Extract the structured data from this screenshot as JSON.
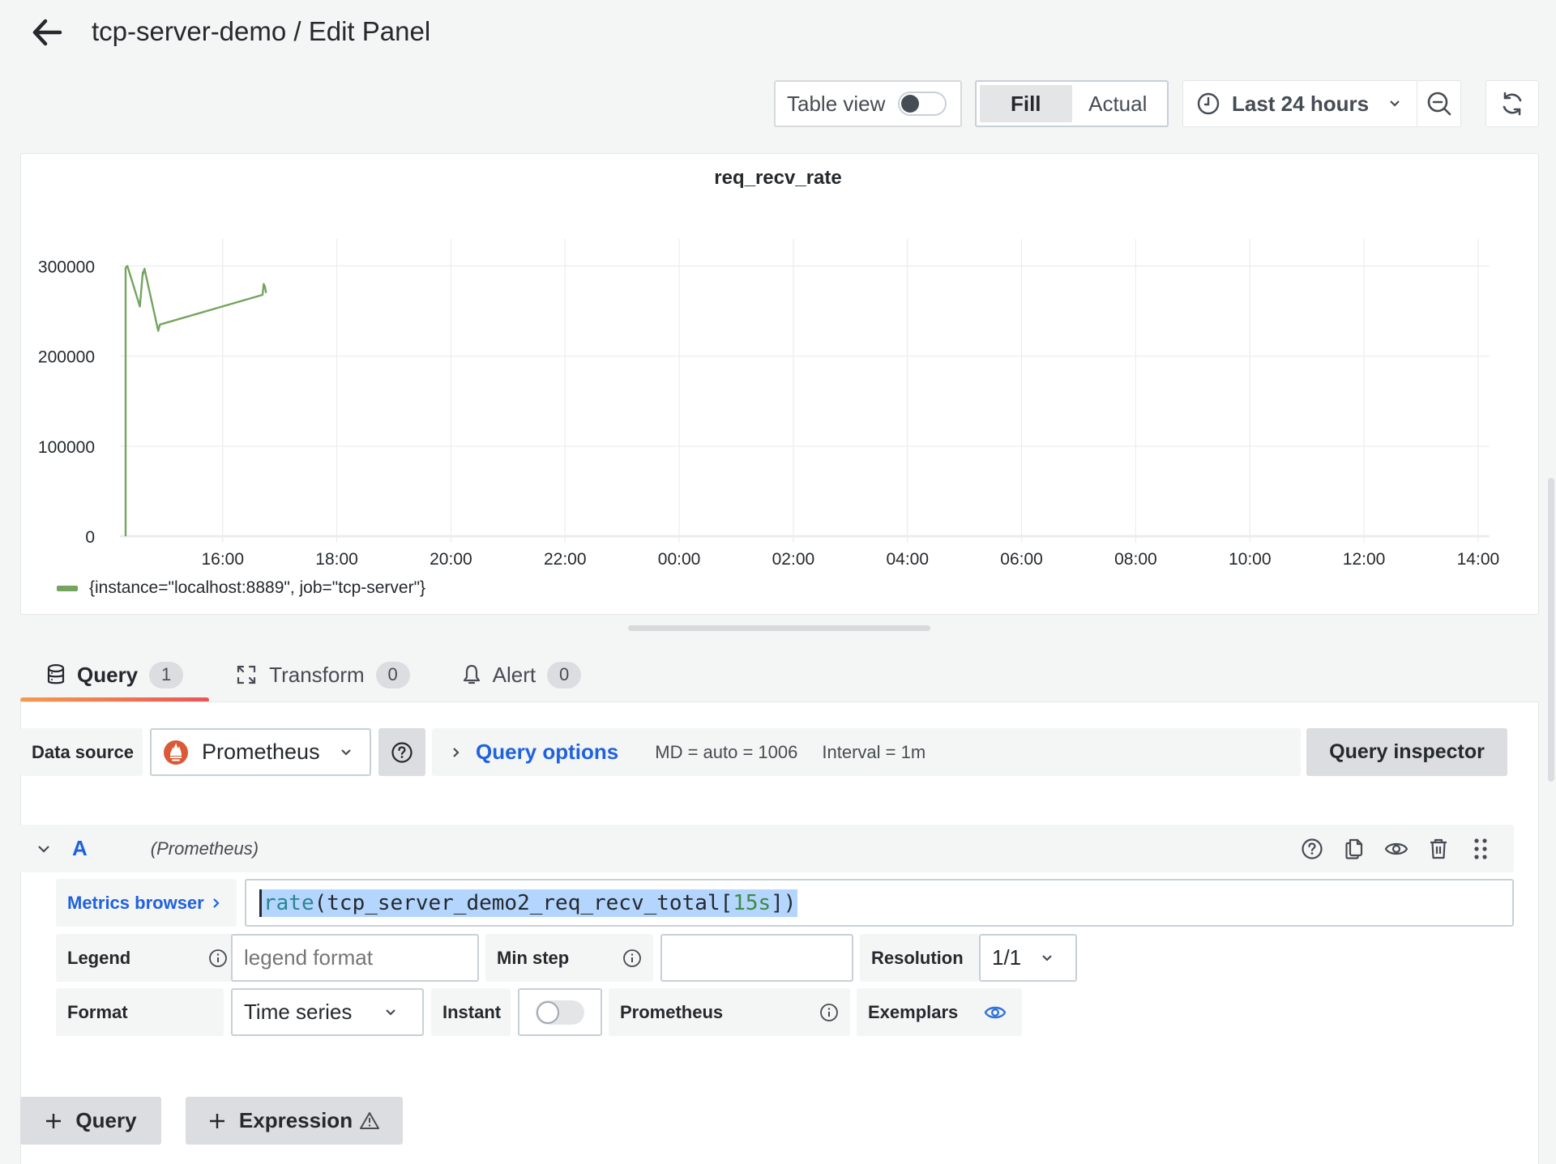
{
  "header": {
    "title": "tcp-server-demo / Edit Panel",
    "back_icon": "arrow-left-icon"
  },
  "toolbar": {
    "table_view_label": "Table view",
    "table_view_on": false,
    "fill_label": "Fill",
    "actual_label": "Actual",
    "selected_mode": "Fill",
    "time_range_label": "Last 24 hours",
    "time_icon": "clock-icon",
    "zoom_out_icon": "zoom-out-icon",
    "refresh_icon": "refresh-icon"
  },
  "panel": {
    "title": "req_recv_rate",
    "legend_label": "{instance=\"localhost:8889\", job=\"tcp-server\"}",
    "series_color": "#73a55e"
  },
  "chart_data": {
    "type": "line",
    "title": "req_recv_rate",
    "xlabel": "",
    "ylabel": "",
    "grid": true,
    "legend_position": "bottom-left",
    "y_ticks": [
      0,
      100000,
      200000,
      300000
    ],
    "y_tick_labels": [
      "0",
      "100000",
      "200000",
      "300000"
    ],
    "ylim": [
      0,
      330000
    ],
    "x_tick_labels": [
      "16:00",
      "18:00",
      "20:00",
      "22:00",
      "00:00",
      "02:00",
      "04:00",
      "06:00",
      "08:00",
      "10:00",
      "12:00",
      "14:00"
    ],
    "x_ticks_hours": [
      16,
      18,
      20,
      22,
      24,
      26,
      28,
      30,
      32,
      34,
      36,
      38
    ],
    "xlim_hours": [
      14.2,
      38.2
    ],
    "series": [
      {
        "name": "{instance=\"localhost:8889\", job=\"tcp-server\"}",
        "color": "#73a55e",
        "x_hours": [
          14.3,
          14.3,
          14.33,
          14.55,
          14.6,
          14.6,
          14.63,
          14.87,
          14.9,
          16.7,
          16.72,
          16.74,
          16.76
        ],
        "values": [
          0,
          298000,
          300000,
          255000,
          293000,
          290000,
          297000,
          228000,
          235000,
          268000,
          280000,
          277000,
          270000
        ]
      }
    ]
  },
  "tabs": [
    {
      "label": "Query",
      "count": "1",
      "icon": "database-icon",
      "active": true
    },
    {
      "label": "Transform",
      "count": "0",
      "icon": "transform-icon",
      "active": false
    },
    {
      "label": "Alert",
      "count": "0",
      "icon": "bell-icon",
      "active": false
    }
  ],
  "datasource": {
    "label": "Data source",
    "selected": "Prometheus",
    "query_options_label": "Query options",
    "md_info": "MD = auto = 1006",
    "interval_info": "Interval = 1m",
    "query_inspector_label": "Query inspector"
  },
  "query": {
    "ref_id": "A",
    "datasource_name": "(Prometheus)",
    "metrics_browser_label": "Metrics browser",
    "expr_fn": "rate",
    "expr_open": "(tcp_server_demo2_req_recv_total[",
    "expr_range": "15s",
    "expr_close": "])",
    "legend_label": "Legend",
    "legend_placeholder": "legend format",
    "legend_value": "",
    "min_step_label": "Min step",
    "min_step_value": "",
    "resolution_label": "Resolution",
    "resolution_value": "1/1",
    "format_label": "Format",
    "format_value": "Time series",
    "instant_label": "Instant",
    "instant_on": false,
    "prometheus_label": "Prometheus",
    "exemplars_label": "Exemplars",
    "exemplars_on": true
  },
  "footer": {
    "add_query_label": "Query",
    "add_expression_label": "Expression"
  }
}
